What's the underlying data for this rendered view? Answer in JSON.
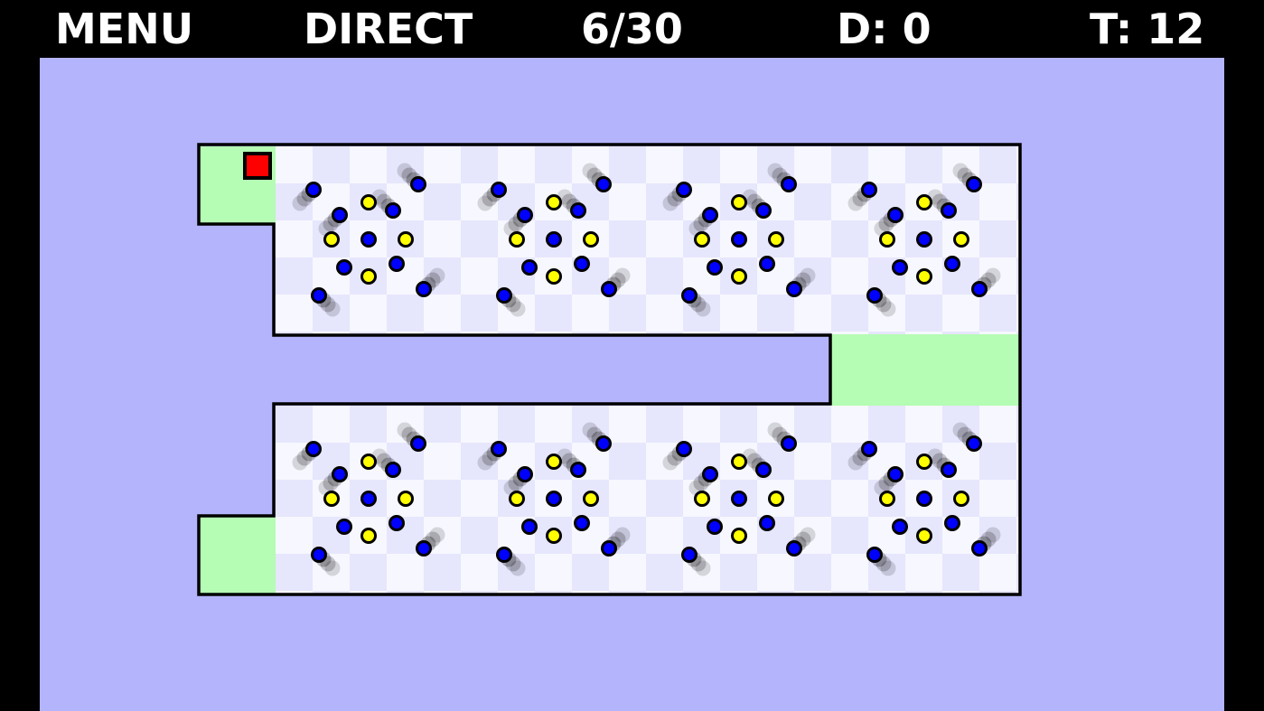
{
  "hud": {
    "menu_label": "MENU",
    "mode_label": "DIRECT",
    "level": "6/30",
    "deaths": "D: 0",
    "time": "T: 12"
  },
  "colors": {
    "frame": "#000000",
    "hud_text": "#ffffff",
    "background": "#b4b4fc",
    "tile_light": "#f7f7ff",
    "tile_dark": "#e6e6fd",
    "safe_zone": "#b5fcb4",
    "player": "#ff0000",
    "enemy": "#0000ff",
    "coin": "#ffff00",
    "outline": "#000000"
  },
  "game": {
    "player": {
      "name": "player-square",
      "icon": "red-square"
    },
    "zones": [
      {
        "name": "start-zone"
      },
      {
        "name": "checkpoint-zone"
      },
      {
        "name": "goal-zone"
      }
    ],
    "clusters": [
      {
        "name": "cluster-top-1"
      },
      {
        "name": "cluster-top-2"
      },
      {
        "name": "cluster-top-3"
      },
      {
        "name": "cluster-top-4"
      },
      {
        "name": "cluster-bottom-1"
      },
      {
        "name": "cluster-bottom-2"
      },
      {
        "name": "cluster-bottom-3"
      },
      {
        "name": "cluster-bottom-4"
      }
    ],
    "coins_per_cluster": 4,
    "enemies_per_cluster": 9
  }
}
